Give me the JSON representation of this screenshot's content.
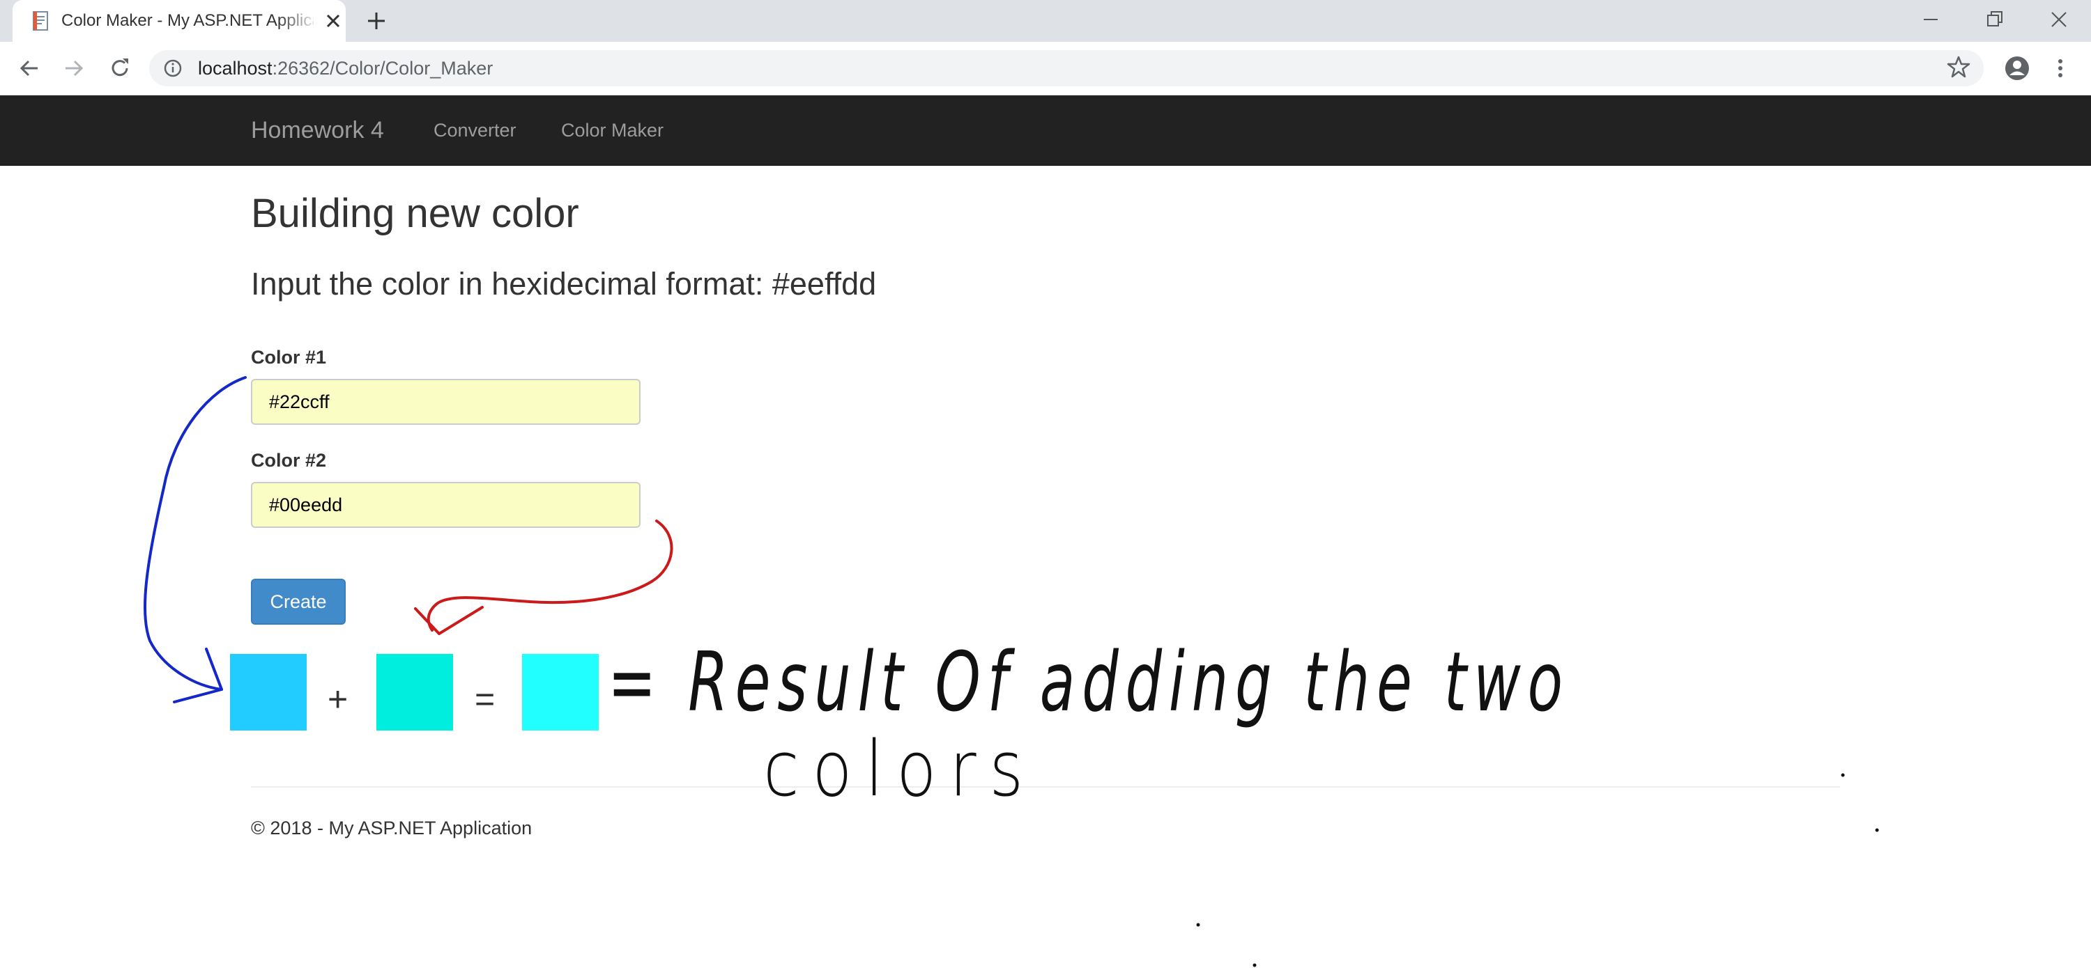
{
  "browser": {
    "tab_title": "Color Maker - My ASP.NET Application",
    "url_host": "localhost",
    "url_rest": ":26362/Color/Color_Maker"
  },
  "navbar": {
    "brand": "Homework 4",
    "links": [
      "Converter",
      "Color Maker"
    ]
  },
  "page": {
    "heading": "Building new color",
    "instruction": "Input the color in hexidecimal format: #eeffdd",
    "color1_label": "Color #1",
    "color1_value": "#22ccff",
    "color2_label": "Color #2",
    "color2_value": "#00eedd",
    "create_label": "Create",
    "plus": "+",
    "equals": "=",
    "swatch_colors": [
      "#22ccff",
      "#00eedd",
      "#22ffff"
    ]
  },
  "annotation": {
    "handwriting_line1": "= Result Of adding the two",
    "handwriting_line2": "colors"
  },
  "footer": {
    "copyright": "© 2018 - My ASP.NET Application"
  }
}
